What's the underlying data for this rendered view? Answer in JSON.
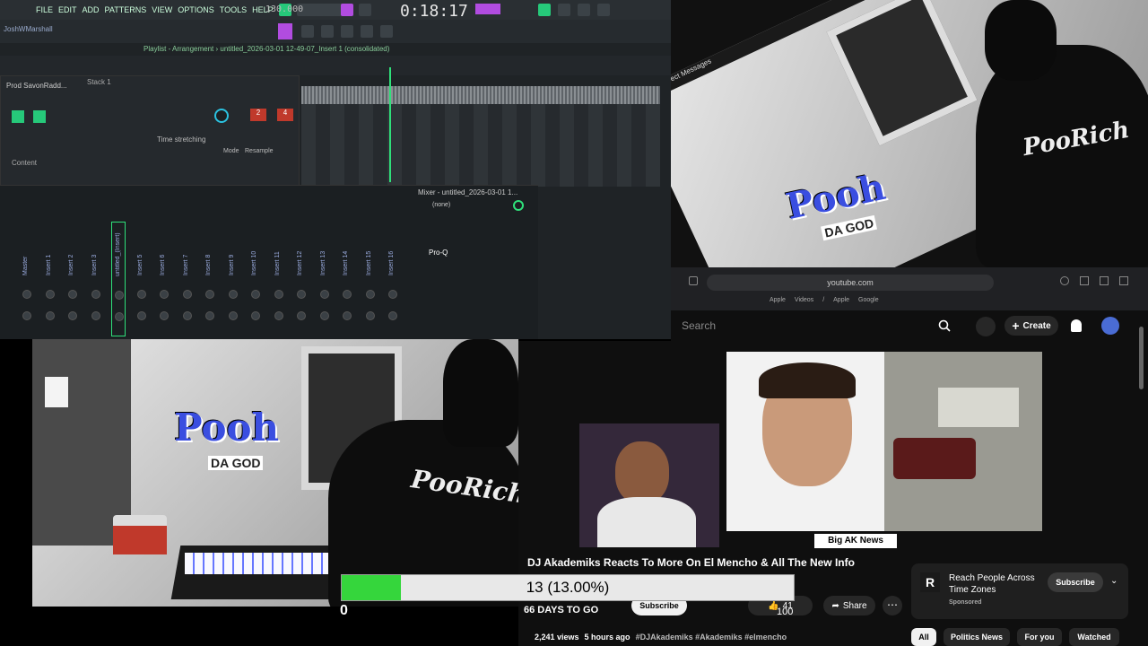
{
  "daw": {
    "menu": [
      "FILE",
      "EDIT",
      "ADD",
      "PATTERNS",
      "VIEW",
      "OPTIONS",
      "TOOLS",
      "HELP"
    ],
    "tempo": "130.000",
    "clock": "0:18:17",
    "user": "JoshWMarshall",
    "arrangement_label": "Playlist - Arrangement › untitled_2026-03-01 12-49-07_Insert 1 (consolidated)",
    "plugin_title": "Prod SavonRadd...",
    "stack_label": "Stack 1",
    "time_stretching": "Time stretching",
    "mode_label": "Mode",
    "resample_label": "Resample",
    "content_label": "Content",
    "mixer_title": "Mixer - untitled_2026-03-01 1...",
    "mixer_slot": "(none)",
    "mixer_fx": "Pro-Q",
    "tracks": [
      "Master",
      "Insert 1",
      "Insert 2",
      "Insert 3",
      "untitled_(Insert)",
      "Insert 5",
      "Insert 6",
      "Insert 7",
      "Insert 8",
      "Insert 9",
      "Insert 10",
      "Insert 11",
      "Insert 12",
      "Insert 13",
      "Insert 14",
      "Insert 15",
      "Insert 16"
    ]
  },
  "stream_top": {
    "panel_label": "Direct Messages",
    "logo": "Pooh",
    "logo_sub": "DA GOD",
    "hoodie_text": "PooRich"
  },
  "browser": {
    "url": "youtube.com",
    "bookmarks": [
      "Apple",
      "Videos",
      "/",
      "Apple",
      "Google"
    ],
    "search_placeholder": "Search",
    "create_label": "Create"
  },
  "stream_bottom": {
    "logo": "Pooh",
    "logo_sub": "DA GOD",
    "hoodie_text": "PooRich"
  },
  "youtube": {
    "news_tag": "Big AK News",
    "video_title": "DJ Akademiks Reacts To More On El Mencho & All The New Info",
    "subscribe": "Subscribe",
    "views": "2,241 views",
    "time_ago": "5 hours ago",
    "hashtags": "#DJAkademiks #Akademiks #elmencho",
    "like_count": "41",
    "share": "Share",
    "sponsor_title": "Reach People Across Time Zones",
    "sponsor_sub": "Sponsored",
    "sponsor_btn": "Subscribe",
    "chips": [
      "All",
      "Politics News",
      "For you",
      "Watched"
    ]
  },
  "overlay": {
    "label": "13 (13.00%)",
    "fill_fraction": 0.13,
    "min": "0",
    "max": "100",
    "days": "66 DAYS TO GO"
  },
  "colors": {
    "accent_green": "#2fe07a",
    "overlay_green": "#35d63c",
    "logo_blue": "#3a4ee0"
  }
}
